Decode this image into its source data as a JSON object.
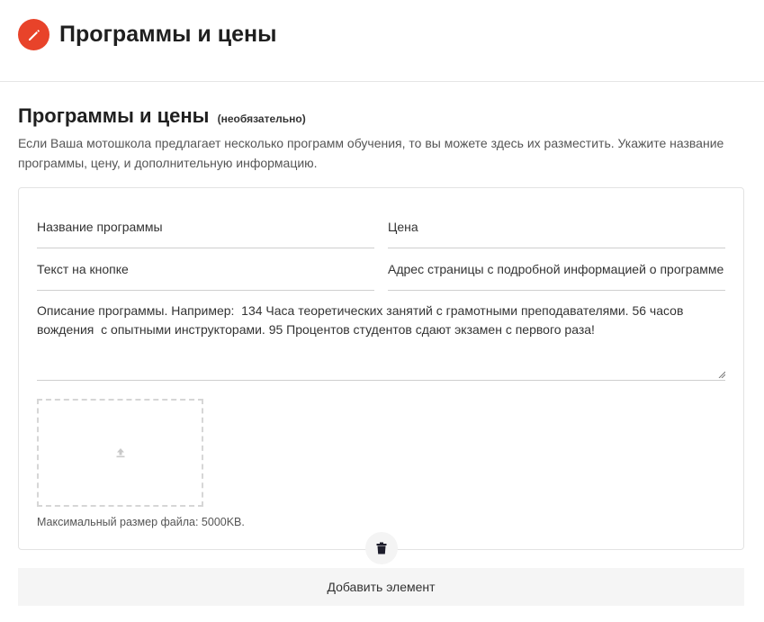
{
  "header": {
    "title": "Программы и цены",
    "icon": "pencil-icon",
    "accent_color": "#e8432a"
  },
  "section": {
    "title": "Программы и цены",
    "optional_label": "(необязательно)",
    "description": "Если Ваша мотошкола предлагает несколько программ обучения, то вы можете здесь их разместить. Укажите название программы, цену, и дополнительную информацию."
  },
  "form": {
    "program_name": {
      "placeholder": "Название программы",
      "value": ""
    },
    "price": {
      "placeholder": "Цена",
      "value": ""
    },
    "button_text": {
      "placeholder": "Текст на кнопке",
      "value": ""
    },
    "details_url": {
      "placeholder": "Адрес страницы с подробной информацией о программе",
      "value": ""
    },
    "description": {
      "placeholder": "Описание программы. Например:  134 Часа теоретических занятий с грамотными преподавателями. 56 часов вождения  с опытными инструкторами. 95 Процентов студентов сдают экзамен с первого раза!",
      "value": ""
    },
    "upload": {
      "icon": "upload-icon",
      "hint": "Максимальный размер файла: 5000KB."
    }
  },
  "actions": {
    "delete_icon": "trash-icon",
    "add_label": "Добавить элемент"
  }
}
